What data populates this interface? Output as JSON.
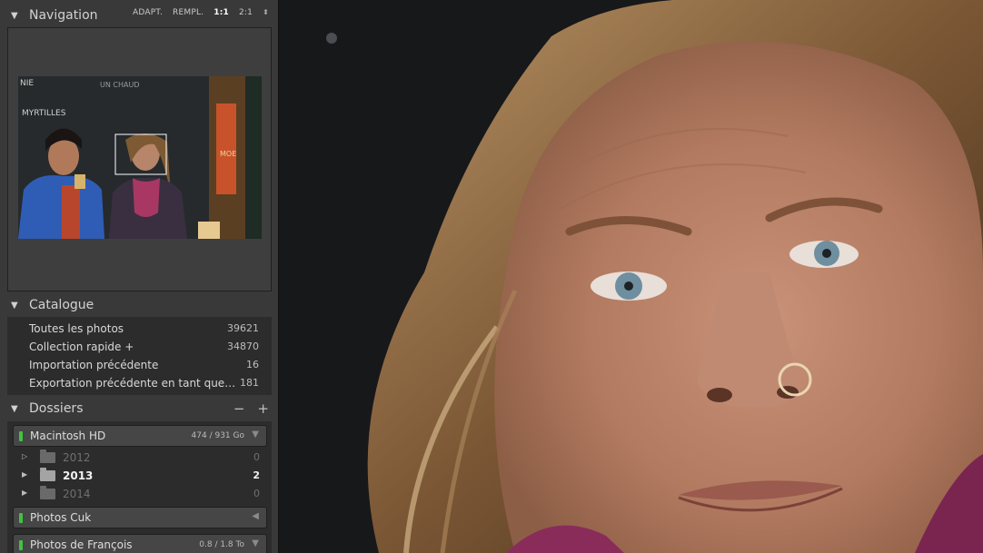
{
  "navigation": {
    "title": "Navigation",
    "zoom_options": [
      "ADAPT.",
      "REMPL.",
      "1:1",
      "2:1"
    ],
    "active_zoom": "1:1"
  },
  "catalogue": {
    "title": "Catalogue",
    "items": [
      {
        "label": "Toutes les photos",
        "count": "39621"
      },
      {
        "label": "Collection rapide +",
        "count": "34870"
      },
      {
        "label": "Importation précédente",
        "count": "16"
      },
      {
        "label": "Exportation précédente en tant que…",
        "count": "181"
      }
    ]
  },
  "dossiers": {
    "title": "Dossiers",
    "volumes": [
      {
        "name": "Macintosh HD",
        "capacity": "474 / 931 Go"
      },
      {
        "name": "Photos Cuk",
        "capacity": ""
      },
      {
        "name": "Photos de François",
        "capacity": "0.8 / 1.8 To"
      }
    ],
    "folders": [
      {
        "name": "2012",
        "count": "0"
      },
      {
        "name": "2013",
        "count": "2"
      },
      {
        "name": "2014",
        "count": "0"
      }
    ]
  },
  "thumbnail_text": [
    "NIE",
    "MYRTILLES",
    "UN CHAUD",
    "MOE"
  ],
  "colors": {
    "panel_bg": "#393939",
    "section_bg": "#2c2c2c",
    "volume_led": "#41c241",
    "text": "#d8d8d8"
  }
}
